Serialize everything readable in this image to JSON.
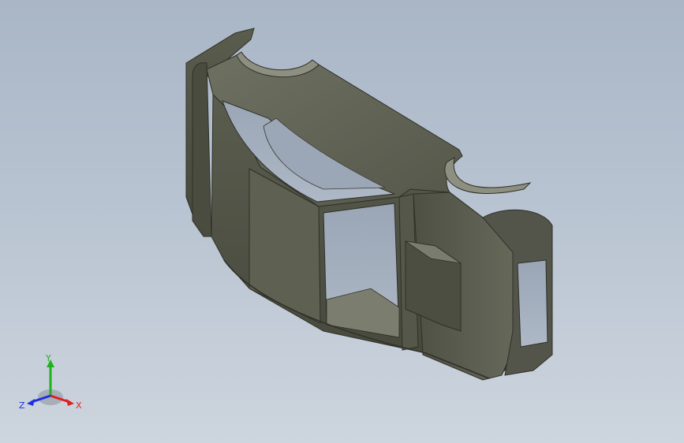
{
  "viewport": {
    "background_top": "#a9b6c6",
    "background_bottom": "#cdd5de",
    "model_color": "#5b5d4f",
    "model_highlight": "#8a8c7c",
    "model_shadow": "#3b3c33"
  },
  "triad": {
    "x_label": "X",
    "y_label": "Y",
    "z_label": "Z",
    "x_color": "#e02020",
    "y_color": "#20b020",
    "z_color": "#2030e0"
  }
}
